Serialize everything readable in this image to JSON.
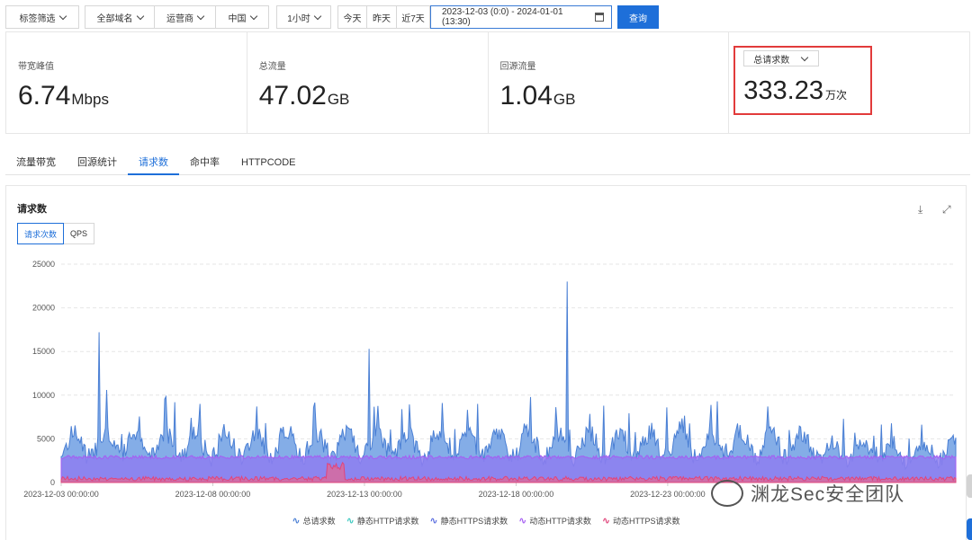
{
  "filters": {
    "tag_filter": "标签筛选",
    "domain": "全部域名",
    "isp": "运营商",
    "region": "中国",
    "granularity": "1小时",
    "today": "今天",
    "yesterday": "昨天",
    "last7": "近7天",
    "date_range": "2023-12-03 (0:0) - 2024-01-01 (13:30)",
    "query": "查询"
  },
  "stats": [
    {
      "label": "带宽峰值",
      "value": "6.74",
      "unit": "Mbps"
    },
    {
      "label": "总流量",
      "value": "47.02",
      "unit": "GB"
    },
    {
      "label": "回源流量",
      "value": "1.04",
      "unit": "GB"
    }
  ],
  "highlight": {
    "select": "总请求数",
    "value": "333.23",
    "unit": "万次",
    "border_color": "#e23b3b"
  },
  "tabs": [
    "流量带宽",
    "回源统计",
    "请求数",
    "命中率",
    "HTTPCODE"
  ],
  "active_tab": 2,
  "panel": {
    "title": "请求数",
    "seg_count": "请求次数",
    "seg_qps": "QPS",
    "download_icon": "download-icon",
    "fullscreen_icon": "fullscreen-icon"
  },
  "chart_data": {
    "type": "area",
    "y_ticks": [
      0,
      5000,
      10000,
      15000,
      20000,
      25000
    ],
    "ylim": [
      0,
      25000
    ],
    "x_tick_labels": [
      "2023-12-03 00:00:00",
      "2023-12-08 00:00:00",
      "2023-12-13 00:00:00",
      "2023-12-18 00:00:00",
      "2023-12-23 00:00:00"
    ],
    "grid": "horizontal-dashed",
    "legend_position": "bottom",
    "series": [
      {
        "name": "总请求数",
        "color": "#4a7fd4"
      },
      {
        "name": "静态HTTP请求数",
        "color": "#3ec9c0"
      },
      {
        "name": "静态HTTPS请求数",
        "color": "#5b6ee0"
      },
      {
        "name": "动态HTTP请求数",
        "color": "#a55ef2"
      },
      {
        "name": "动态HTTPS请求数",
        "color": "#e0457b"
      }
    ],
    "approx_baselines": {
      "总请求数": 3000,
      "动态HTTP请求数": 2900,
      "动态HTTPS请求数": 300
    },
    "approx_peaks": {
      "2023-12-03 12:00": 17200,
      "2023-12-13 00:00": 15300,
      "2023-12-19 20:00": 23000,
      "2023-12-04 12:00": 10600
    }
  },
  "watermark": "渊龙Sec安全团队"
}
